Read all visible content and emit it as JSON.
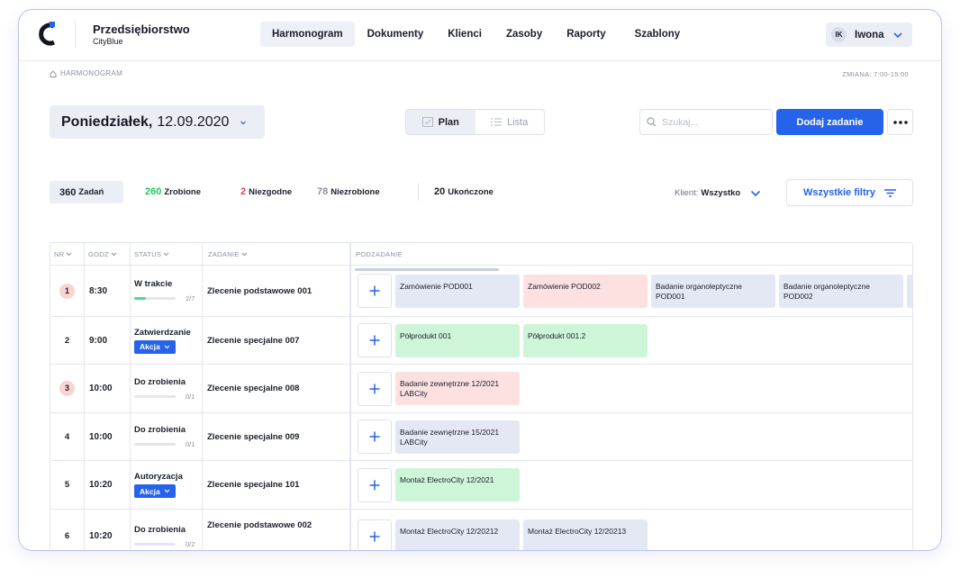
{
  "header": {
    "company_name": "Przedsiębiorstwo",
    "company_sub": "CityBlue",
    "nav": [
      "Harmonogram",
      "Dokumenty",
      "Klienci",
      "Zasoby",
      "Raporty",
      "Szablony"
    ],
    "user_initials": "IK",
    "user_name": "Iwona",
    "accent": "#2563eb"
  },
  "breadcrumb": "HARMONOGRAM",
  "shift": "ZMIANA: 7:00-15:00",
  "date": {
    "day": "Poniedziałek,",
    "value": "12.09.2020"
  },
  "views": {
    "plan": "Plan",
    "list": "Lista"
  },
  "search": {
    "placeholder": "Szukaj..."
  },
  "add_button": "Dodaj zadanie",
  "stats": {
    "all_num": "360",
    "all_label": "Zadań",
    "done_num": "260",
    "done_label": "Zrobione",
    "done_color": "#22c55e",
    "nonconf_num": "2",
    "nonconf_label": "Niezgodne",
    "nonconf_color": "#ef4444",
    "undone_num": "78",
    "undone_label": "Niezrobione",
    "undone_color": "#8a90a3",
    "finished_num": "20",
    "finished_label": "Ukończone"
  },
  "client_filter": {
    "label": "Klient:",
    "value": "Wszystko"
  },
  "filters_button": "Wszystkie filtry",
  "columns": [
    "NR",
    "GODZ",
    "STATUS",
    "ZADANIE",
    "PODZADANIE"
  ],
  "rows": [
    {
      "nr": "1",
      "badge": true,
      "time": "8:30",
      "status": "W trakcie",
      "progress": "2/7",
      "progress_frac": 0.28,
      "action": null,
      "task": "Zlecenie podstawowe 001",
      "subtasks": [
        {
          "text": "Zamówienie POD001",
          "color": "blue"
        },
        {
          "text": "Zamówienie POD002",
          "color": "red"
        },
        {
          "text": "Badanie organoleptyczne POD001",
          "color": "blue"
        },
        {
          "text": "Badanie organoleptyczne POD002",
          "color": "blue"
        },
        {
          "text": "",
          "color": "blue"
        }
      ]
    },
    {
      "nr": "2",
      "badge": false,
      "time": "9:00",
      "status": "Zatwierdzanie",
      "progress": null,
      "progress_frac": null,
      "action": "Akcja",
      "task": "Zlecenie specjalne 007",
      "subtasks": [
        {
          "text": "Półprodukt 001",
          "color": "green"
        },
        {
          "text": "Półprodukt 001.2",
          "color": "green"
        }
      ]
    },
    {
      "nr": "3",
      "badge": true,
      "time": "10:00",
      "status": "Do zrobienia",
      "progress": "0/1",
      "progress_frac": 0,
      "action": null,
      "task": "Zlecenie specjalne 008",
      "subtasks": [
        {
          "text": "Badanie zewnętrzne 12/2021 LABCity",
          "color": "red"
        }
      ]
    },
    {
      "nr": "4",
      "badge": false,
      "time": "10:00",
      "status": "Do zrobienia",
      "progress": "0/1",
      "progress_frac": 0,
      "action": null,
      "task": "Zlecenie specjalne 009",
      "subtasks": [
        {
          "text": "Badanie zewnętrzne 15/2021 LABCity",
          "color": "blue"
        }
      ]
    },
    {
      "nr": "5",
      "badge": false,
      "time": "10:20",
      "status": "Autoryzacja",
      "progress": null,
      "progress_frac": null,
      "action": "Akcja",
      "task": "Zlecenie specjalne 101",
      "subtasks": [
        {
          "text": "Montaż ElectroCity 12/2021",
          "color": "green"
        }
      ]
    },
    {
      "nr": "6",
      "badge": false,
      "time": "10:20",
      "status": "Do zrobienia",
      "progress": "0/2",
      "progress_frac": 0,
      "action": null,
      "task": "Zlecenie podstawowe 002",
      "subtasks": [
        {
          "text": "Montaż ElectroCity 12/20212",
          "color": "blue"
        },
        {
          "text": "Montaż ElectroCity 12/20213",
          "color": "blue"
        }
      ]
    }
  ]
}
